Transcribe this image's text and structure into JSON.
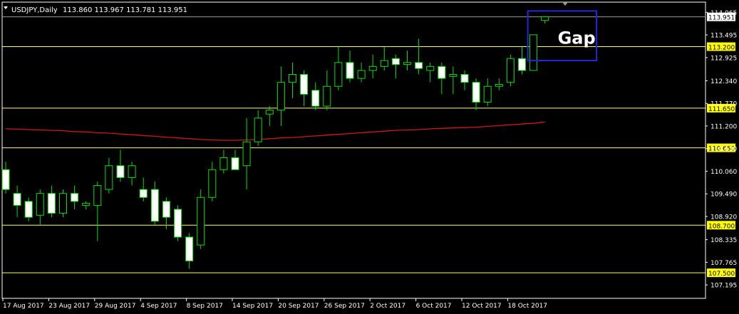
{
  "header": {
    "symbol_tf": "USDJPY,Daily",
    "ohlc": "113.860 113.967 113.781 113.951"
  },
  "annotation": {
    "text": "Gap",
    "box_color": "#1f2ad6",
    "x_from": 46,
    "x_to": 51,
    "price_from": 112.85,
    "price_to": 114.1
  },
  "colors": {
    "background": "#000000",
    "frame": "#ffffff",
    "bull": "#00e000",
    "bear_body": "#ffffff",
    "level_line": "#ffff66",
    "level_label_bg": "#ffff00",
    "ma": "#d01818",
    "gap_box": "#1f2ad6"
  },
  "chart_data": {
    "type": "candlestick",
    "y_range": [
      107.0,
      114.25
    ],
    "y_ticks": [
      "114.065",
      "113.495",
      "112.925",
      "112.340",
      "111.770",
      "111.200",
      "110.630",
      "110.060",
      "109.490",
      "108.920",
      "108.335",
      "107.765",
      "107.195"
    ],
    "x_tick_labels": [
      "17 Aug 2017",
      "23 Aug 2017",
      "29 Aug 2017",
      "4 Sep 2017",
      "8 Sep 2017",
      "14 Sep 2017",
      "20 Sep 2017",
      "26 Sep 2017",
      "2 Oct 2017",
      "6 Oct 2017",
      "12 Oct 2017",
      "18 Oct 2017"
    ],
    "x_tick_index": [
      0,
      4,
      8,
      12,
      16,
      20,
      24,
      28,
      32,
      36,
      40,
      44
    ],
    "current_price": "113.951",
    "levels": [
      "113.200",
      "111.650",
      "110.650",
      "108.700",
      "107.500"
    ],
    "candles": [
      {
        "o": 110.1,
        "h": 110.3,
        "l": 109.5,
        "c": 109.6
      },
      {
        "o": 109.5,
        "h": 109.7,
        "l": 108.9,
        "c": 109.2
      },
      {
        "o": 109.3,
        "h": 109.4,
        "l": 108.8,
        "c": 108.9
      },
      {
        "o": 108.95,
        "h": 109.6,
        "l": 108.7,
        "c": 109.5
      },
      {
        "o": 109.5,
        "h": 109.7,
        "l": 108.9,
        "c": 109.0
      },
      {
        "o": 109.0,
        "h": 109.6,
        "l": 108.9,
        "c": 109.5
      },
      {
        "o": 109.5,
        "h": 109.7,
        "l": 109.1,
        "c": 109.3
      },
      {
        "o": 109.2,
        "h": 109.3,
        "l": 109.1,
        "c": 109.25
      },
      {
        "o": 109.2,
        "h": 109.8,
        "l": 108.3,
        "c": 109.7
      },
      {
        "o": 109.6,
        "h": 110.4,
        "l": 109.5,
        "c": 110.2
      },
      {
        "o": 110.2,
        "h": 110.6,
        "l": 109.8,
        "c": 109.9
      },
      {
        "o": 109.9,
        "h": 110.3,
        "l": 109.7,
        "c": 110.2
      },
      {
        "o": 109.6,
        "h": 109.9,
        "l": 109.3,
        "c": 109.4
      },
      {
        "o": 109.6,
        "h": 109.8,
        "l": 108.7,
        "c": 108.8
      },
      {
        "o": 109.3,
        "h": 109.4,
        "l": 108.6,
        "c": 108.9
      },
      {
        "o": 109.1,
        "h": 109.2,
        "l": 108.3,
        "c": 108.4
      },
      {
        "o": 108.4,
        "h": 108.5,
        "l": 107.6,
        "c": 107.8
      },
      {
        "o": 108.2,
        "h": 109.6,
        "l": 108.1,
        "c": 109.4
      },
      {
        "o": 109.4,
        "h": 110.3,
        "l": 109.3,
        "c": 110.1
      },
      {
        "o": 110.1,
        "h": 110.6,
        "l": 110.0,
        "c": 110.4
      },
      {
        "o": 110.4,
        "h": 110.6,
        "l": 110.1,
        "c": 110.1
      },
      {
        "o": 110.2,
        "h": 111.4,
        "l": 109.6,
        "c": 110.8
      },
      {
        "o": 110.8,
        "h": 111.6,
        "l": 110.7,
        "c": 111.4
      },
      {
        "o": 111.5,
        "h": 111.7,
        "l": 111.2,
        "c": 111.6
      },
      {
        "o": 111.6,
        "h": 112.7,
        "l": 111.2,
        "c": 112.3
      },
      {
        "o": 112.3,
        "h": 112.8,
        "l": 111.9,
        "c": 112.5
      },
      {
        "o": 112.5,
        "h": 112.6,
        "l": 111.7,
        "c": 112.0
      },
      {
        "o": 112.1,
        "h": 112.3,
        "l": 111.6,
        "c": 111.7
      },
      {
        "o": 111.7,
        "h": 112.6,
        "l": 111.6,
        "c": 112.2
      },
      {
        "o": 112.2,
        "h": 113.2,
        "l": 112.1,
        "c": 112.8
      },
      {
        "o": 112.8,
        "h": 113.1,
        "l": 112.3,
        "c": 112.4
      },
      {
        "o": 112.4,
        "h": 112.8,
        "l": 112.3,
        "c": 112.6
      },
      {
        "o": 112.6,
        "h": 113.0,
        "l": 112.4,
        "c": 112.7
      },
      {
        "o": 112.7,
        "h": 113.2,
        "l": 112.6,
        "c": 112.85
      },
      {
        "o": 112.9,
        "h": 113.0,
        "l": 112.4,
        "c": 112.75
      },
      {
        "o": 112.75,
        "h": 113.1,
        "l": 112.6,
        "c": 112.8
      },
      {
        "o": 112.8,
        "h": 113.4,
        "l": 112.5,
        "c": 112.65
      },
      {
        "o": 112.6,
        "h": 112.8,
        "l": 112.3,
        "c": 112.7
      },
      {
        "o": 112.7,
        "h": 112.8,
        "l": 112.0,
        "c": 112.4
      },
      {
        "o": 112.45,
        "h": 112.7,
        "l": 112.0,
        "c": 112.5
      },
      {
        "o": 112.5,
        "h": 112.6,
        "l": 112.1,
        "c": 112.3
      },
      {
        "o": 112.3,
        "h": 112.4,
        "l": 111.6,
        "c": 111.8
      },
      {
        "o": 111.8,
        "h": 112.4,
        "l": 111.7,
        "c": 112.2
      },
      {
        "o": 112.2,
        "h": 112.4,
        "l": 112.1,
        "c": 112.25
      },
      {
        "o": 112.3,
        "h": 113.0,
        "l": 112.2,
        "c": 112.9
      },
      {
        "o": 112.9,
        "h": 113.2,
        "l": 112.5,
        "c": 112.6
      },
      {
        "o": 112.6,
        "h": 113.5,
        "l": 112.6,
        "c": 113.5
      },
      {
        "o": 113.86,
        "h": 113.967,
        "l": 113.781,
        "c": 113.951
      }
    ],
    "ma": [
      111.13,
      111.12,
      111.11,
      111.1,
      111.09,
      111.08,
      111.06,
      111.05,
      111.03,
      111.02,
      111.0,
      110.98,
      110.96,
      110.94,
      110.92,
      110.9,
      110.88,
      110.86,
      110.85,
      110.84,
      110.84,
      110.85,
      110.86,
      110.88,
      110.9,
      110.91,
      110.93,
      110.95,
      110.97,
      110.99,
      111.01,
      111.03,
      111.05,
      111.07,
      111.09,
      111.1,
      111.11,
      111.13,
      111.14,
      111.15,
      111.16,
      111.17,
      111.19,
      111.21,
      111.23,
      111.25,
      111.27,
      111.3
    ]
  }
}
